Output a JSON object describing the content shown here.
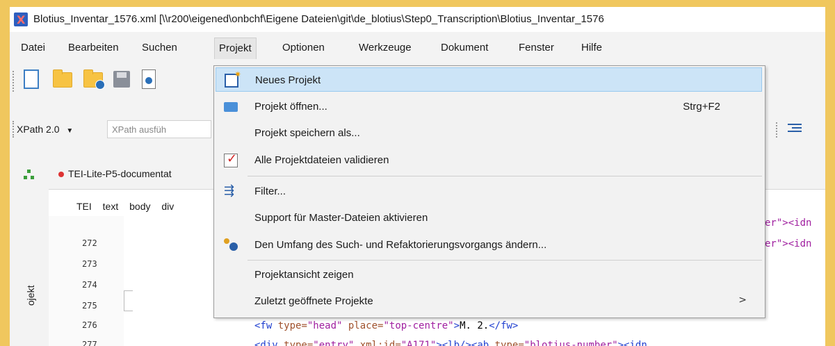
{
  "window": {
    "title": "Blotius_Inventar_1576.xml [\\\\r200\\eigened\\onbchf\\Eigene Dateien\\git\\de_blotius\\Step0_Transcription\\Blotius_Inventar_1576"
  },
  "menubar": {
    "items": [
      "Datei",
      "Bearbeiten",
      "Suchen",
      "Projekt",
      "Optionen",
      "Werkzeuge",
      "Dokument",
      "Fenster",
      "Hilfe"
    ],
    "active": "Projekt"
  },
  "toolbar": {
    "xpath_version": "XPath 2.0",
    "xpath_placeholder": "XPath ausfüh"
  },
  "editor": {
    "tab_label": "TEI-Lite-P5-documentat",
    "breadcrumb": [
      "TEI",
      "text",
      "body",
      "div"
    ],
    "side_panel_label": "ojekt",
    "line_numbers": [
      "272",
      "273",
      "274",
      "275",
      "276",
      "277"
    ],
    "code_fragments": {
      "line_271_tail": "er\"><idn",
      "line_272_tail": "er\"><idn",
      "line_276": {
        "tag_open": "<fw",
        "attr1": " type=",
        "val1": "\"head\"",
        "attr2": " place=",
        "val2": "\"top-centre\"",
        "close": ">",
        "text": "M. 2.",
        "end_tag": "</fw>"
      },
      "line_277": {
        "tag_open": "<div",
        "attr1": " type=",
        "val1": "\"entry\"",
        "attr2": " xml:id=",
        "val2": "\"A171\"",
        "rest1": "><lb/><ab",
        "attr3": " type=",
        "val3": "\"blotius-number\"",
        "rest2": "><idn"
      }
    }
  },
  "projekt_menu": {
    "items": [
      {
        "label": "Neues Projekt",
        "icon": "new-project-icon",
        "highlighted": true
      },
      {
        "label": "Projekt öffnen...",
        "icon": "folder-icon",
        "shortcut": "Strg+F2"
      },
      {
        "label": "Projekt speichern als..."
      },
      {
        "label": "Alle Projektdateien validieren",
        "icon": "validate-icon"
      },
      {
        "label": "Filter...",
        "icon": "filter-icon"
      },
      {
        "label": "Support für Master-Dateien aktivieren"
      },
      {
        "label": "Den Umfang des Such- und Refaktorierungsvorgangs ändern...",
        "icon": "scope-icon"
      },
      {
        "label": "Projektansicht zeigen"
      },
      {
        "label": "Zuletzt geöffnete Projekte",
        "submenu": true
      }
    ],
    "submenu_arrow": ">"
  },
  "colors": {
    "background": "#f0c75e",
    "highlight": "#cce4f7",
    "tag": "#2040d0",
    "attribute_value": "#a020a0"
  }
}
